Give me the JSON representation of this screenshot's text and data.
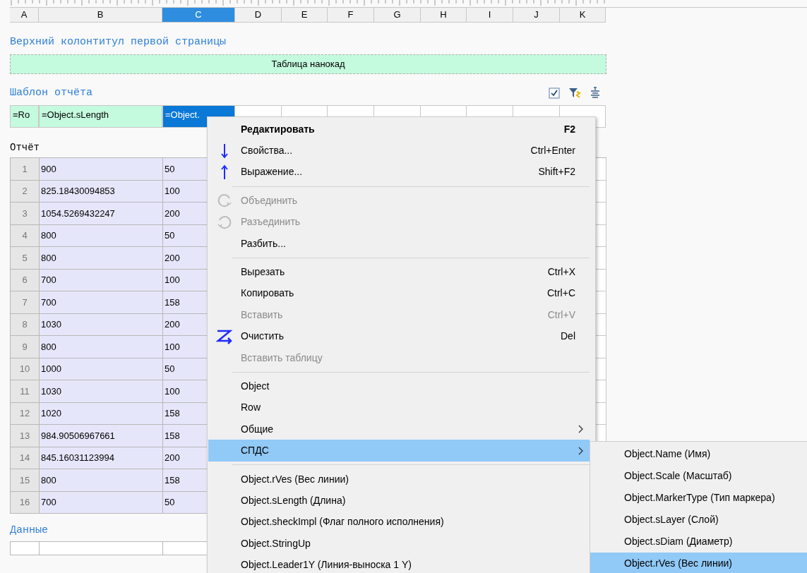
{
  "columns": [
    {
      "label": "A",
      "selected": false
    },
    {
      "label": "B",
      "selected": false
    },
    {
      "label": "C",
      "selected": true
    },
    {
      "label": "D",
      "selected": false
    },
    {
      "label": "E",
      "selected": false
    },
    {
      "label": "F",
      "selected": false
    },
    {
      "label": "G",
      "selected": false
    },
    {
      "label": "H",
      "selected": false
    },
    {
      "label": "I",
      "selected": false
    },
    {
      "label": "J",
      "selected": false
    },
    {
      "label": "K",
      "selected": false
    }
  ],
  "header_section": {
    "title": "Верхний колонтитул первой страницы",
    "band": "Таблица нанокад"
  },
  "template_section": {
    "title": "Шаблон отчёта",
    "cells": [
      {
        "text": "=Ro",
        "selected": false
      },
      {
        "text": "=Object.sLength",
        "selected": false
      },
      {
        "text": "=Object.",
        "selected": true
      }
    ]
  },
  "report_section": {
    "title": "Отчёт",
    "rows": [
      {
        "num": "1",
        "b": "900",
        "c": "50"
      },
      {
        "num": "2",
        "b": "825.18430094853",
        "c": "100"
      },
      {
        "num": "3",
        "b": "1054.5269432247",
        "c": "200"
      },
      {
        "num": "4",
        "b": "800",
        "c": "50"
      },
      {
        "num": "5",
        "b": "800",
        "c": "200"
      },
      {
        "num": "6",
        "b": "700",
        "c": "100"
      },
      {
        "num": "7",
        "b": "700",
        "c": "158"
      },
      {
        "num": "8",
        "b": "1030",
        "c": "200"
      },
      {
        "num": "9",
        "b": "800",
        "c": "100"
      },
      {
        "num": "10",
        "b": "1000",
        "c": "50"
      },
      {
        "num": "11",
        "b": "1030",
        "c": "100"
      },
      {
        "num": "12",
        "b": "1020",
        "c": "158"
      },
      {
        "num": "13",
        "b": "984.90506967661",
        "c": "158"
      },
      {
        "num": "14",
        "b": "845.16031123994",
        "c": "200"
      },
      {
        "num": "15",
        "b": "800",
        "c": "158"
      },
      {
        "num": "16",
        "b": "700",
        "c": "50"
      }
    ]
  },
  "data_section": {
    "title": "Данные"
  },
  "context_menu": {
    "items": [
      {
        "kind": "item",
        "label": "Редактировать",
        "shortcut": "F2",
        "bold": true,
        "disabled": false,
        "submenu": false,
        "selected": false
      },
      {
        "kind": "item",
        "label": "Свойства...",
        "shortcut": "Ctrl+Enter",
        "bold": false,
        "disabled": false,
        "submenu": false,
        "selected": false
      },
      {
        "kind": "item",
        "label": "Выражение...",
        "shortcut": "Shift+F2",
        "bold": false,
        "disabled": false,
        "submenu": false,
        "selected": false
      },
      {
        "kind": "separator"
      },
      {
        "kind": "item",
        "label": "Объединить",
        "bold": false,
        "disabled": true,
        "submenu": false,
        "selected": false
      },
      {
        "kind": "item",
        "label": "Разъединить",
        "bold": false,
        "disabled": true,
        "submenu": false,
        "selected": false
      },
      {
        "kind": "item",
        "label": "Разбить...",
        "bold": false,
        "disabled": false,
        "submenu": false,
        "selected": false
      },
      {
        "kind": "separator"
      },
      {
        "kind": "item",
        "label": "Вырезать",
        "shortcut": "Ctrl+X",
        "bold": false,
        "disabled": false,
        "submenu": false,
        "selected": false
      },
      {
        "kind": "item",
        "label": "Копировать",
        "shortcut": "Ctrl+C",
        "bold": false,
        "disabled": false,
        "submenu": false,
        "selected": false
      },
      {
        "kind": "item",
        "label": "Вставить",
        "shortcut": "Ctrl+V",
        "bold": false,
        "disabled": true,
        "submenu": false,
        "selected": false
      },
      {
        "kind": "item",
        "label": "Очистить",
        "shortcut": "Del",
        "bold": false,
        "disabled": false,
        "submenu": false,
        "selected": false
      },
      {
        "kind": "item",
        "label": "Вставить таблицу",
        "bold": false,
        "disabled": true,
        "submenu": false,
        "selected": false
      },
      {
        "kind": "separator"
      },
      {
        "kind": "item",
        "label": "Object",
        "bold": false,
        "disabled": false,
        "submenu": false,
        "selected": false
      },
      {
        "kind": "item",
        "label": "Row",
        "bold": false,
        "disabled": false,
        "submenu": false,
        "selected": false
      },
      {
        "kind": "item",
        "label": "Общие",
        "bold": false,
        "disabled": false,
        "submenu": true,
        "selected": false
      },
      {
        "kind": "item",
        "label": "СПДС",
        "bold": false,
        "disabled": false,
        "submenu": true,
        "selected": true
      },
      {
        "kind": "separator"
      },
      {
        "kind": "item",
        "label": "Object.rVes (Вес линии)",
        "bold": false,
        "disabled": false,
        "submenu": false,
        "selected": false
      },
      {
        "kind": "item",
        "label": "Object.sLength (Длина)",
        "bold": false,
        "disabled": false,
        "submenu": false,
        "selected": false
      },
      {
        "kind": "item",
        "label": "Object.sheckImpl (Флаг полного исполнения)",
        "bold": false,
        "disabled": false,
        "submenu": false,
        "selected": false
      },
      {
        "kind": "item",
        "label": "Object.StringUp",
        "bold": false,
        "disabled": false,
        "submenu": false,
        "selected": false
      },
      {
        "kind": "item",
        "label": "Object.Leader1Y (Линия-выноска 1 Y)",
        "bold": false,
        "disabled": false,
        "submenu": false,
        "selected": false
      }
    ]
  },
  "submenu": {
    "items": [
      {
        "label": "Object.Name (Имя)",
        "selected": false
      },
      {
        "label": "Object.Scale (Масштаб)",
        "selected": false
      },
      {
        "label": "Object.MarkerType (Тип маркера)",
        "selected": false
      },
      {
        "label": "Object.sLayer (Слой)",
        "selected": false
      },
      {
        "label": "Object.sDiam (Диаметр)",
        "selected": false
      },
      {
        "label": "Object.rVes (Вес линии)",
        "selected": true
      }
    ]
  }
}
